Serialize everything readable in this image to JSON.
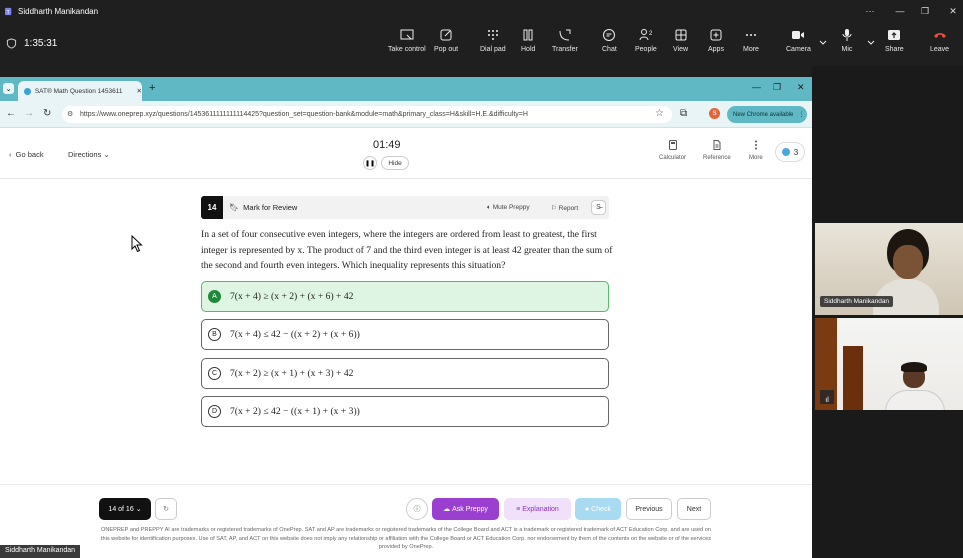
{
  "app": {
    "title": "Siddharth Manikandan",
    "call_timer": "1:35:31"
  },
  "call_toolbar": [
    {
      "label": "Take control"
    },
    {
      "label": "Pop out"
    },
    {
      "label": "Dial pad"
    },
    {
      "label": "Hold"
    },
    {
      "label": "Transfer"
    },
    {
      "label": "Chat"
    },
    {
      "label": "People",
      "count": "2"
    },
    {
      "label": "View"
    },
    {
      "label": "Apps"
    },
    {
      "label": "More"
    },
    {
      "label": "Camera"
    },
    {
      "label": "Mic"
    },
    {
      "label": "Share"
    },
    {
      "label": "Leave"
    }
  ],
  "browser": {
    "tab_title": "SAT® Math Question 1453611",
    "url": "https://www.oneprep.xyz/questions/1453611111111114425?question_set=question-bank&module=math&primary_class=H&skill=H.E.&difficulty=H",
    "new_chrome_label": "New Chrome available",
    "profile_initial": "S"
  },
  "app_header": {
    "go_back": "Go back",
    "directions": "Directions",
    "timer": "01:49",
    "hide": "Hide",
    "calculator": "Calculator",
    "reference": "Reference",
    "more": "More",
    "streak": "3"
  },
  "question": {
    "number": "14",
    "mark_for_review": "Mark for Review",
    "mute": "Mute Preppy",
    "report": "Report",
    "text": "In a set of four consecutive even integers, where the integers are ordered from least to greatest, the first integer is represented by x. The product of 7 and the third even integer is at least 42 greater than the sum of the second and fourth even integers. Which inequality represents this situation?",
    "options": [
      {
        "letter": "A",
        "text": "7(x + 4) ≥ (x + 2) + (x + 6) + 42",
        "selected": true
      },
      {
        "letter": "B",
        "text": "7(x + 4) ≤ 42 − ((x + 2) + (x + 6))",
        "selected": false
      },
      {
        "letter": "C",
        "text": "7(x + 2) ≥ (x + 1) + (x + 3) + 42",
        "selected": false
      },
      {
        "letter": "D",
        "text": "7(x + 2) ≤ 42 − ((x + 1) + (x + 3))",
        "selected": false
      }
    ]
  },
  "footer": {
    "progress": "14 of 16",
    "ask_preppy": "Ask Preppy",
    "explanation": "Explanation",
    "check": "Check",
    "previous": "Previous",
    "next": "Next",
    "disclaimer": "ONEPREP and PREPPY AI are trademarks or registered trademarks of OnePrep. SAT and AP are trademarks or registered trademarks of the College Board and ACT is a trademark or registered trademark of ACT Education Corp. and are used on this website for identification purposes. Use of SAT, AP, and ACT on this website does not imply any relationship or affiliation with the College Board or ACT Education Corp. nor endorsement by them of the contents on the website or of the services provided by OnePrep."
  },
  "participants": [
    {
      "name": "Siddharth Manikandan"
    }
  ],
  "self_label": "Siddharth Manikandan",
  "colors": {
    "accent": "#5fb8c4",
    "selected_green": "#1f8a3a",
    "ask_preppy": "#9b3fd1",
    "leave": "#e74c3c"
  }
}
